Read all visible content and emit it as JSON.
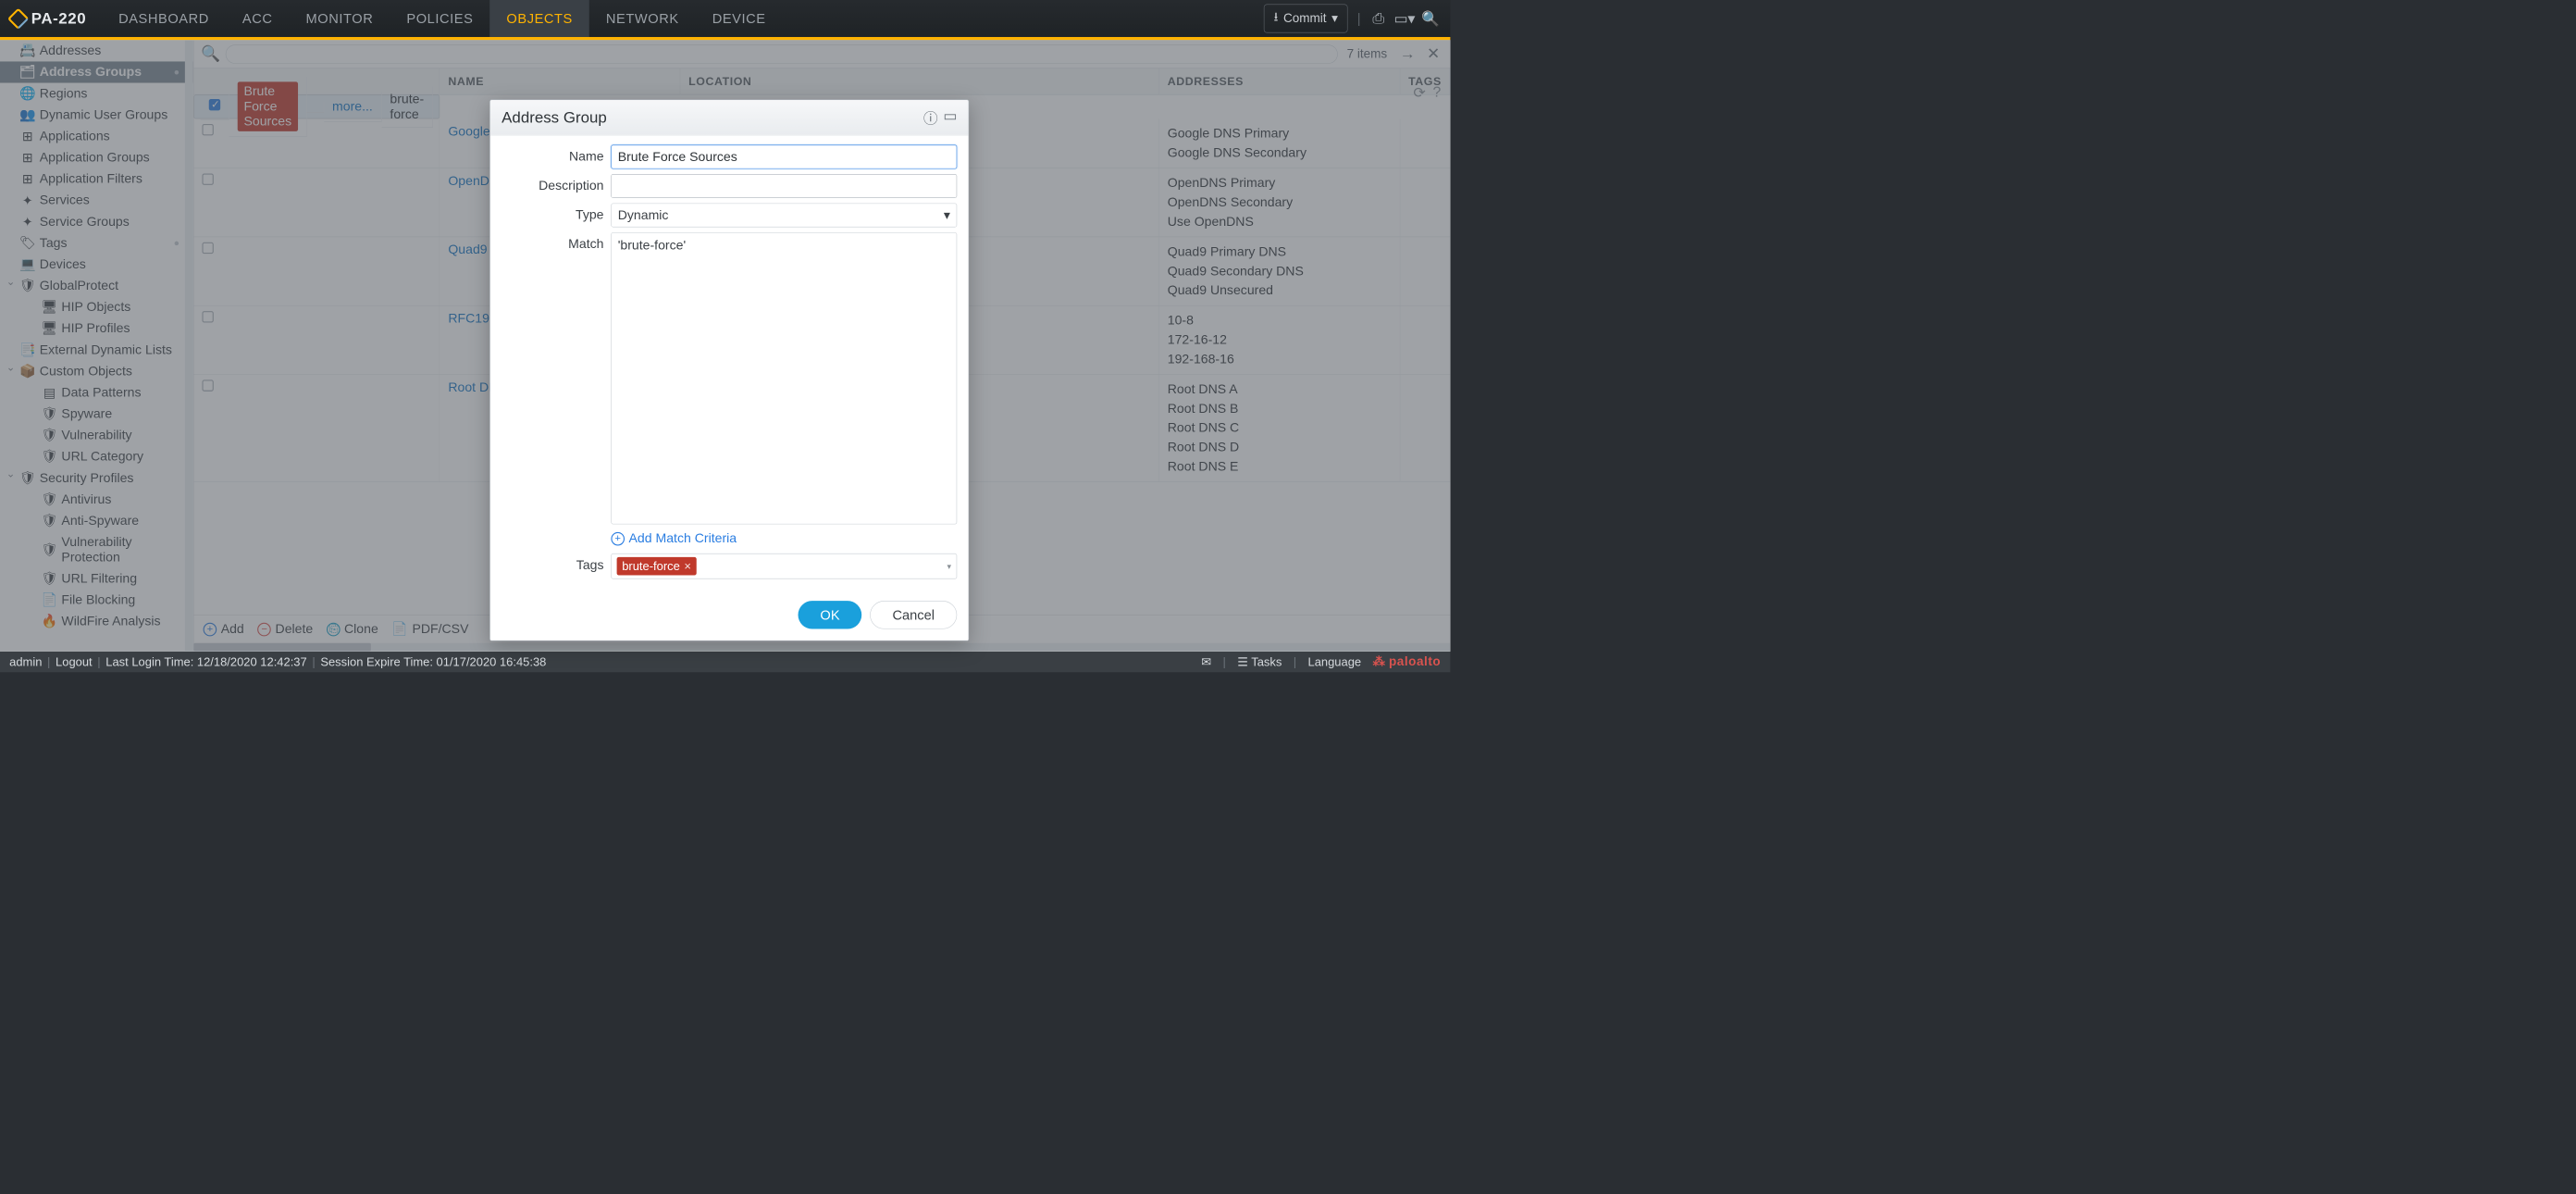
{
  "header": {
    "product": "PA-220",
    "tabs": [
      "DASHBOARD",
      "ACC",
      "MONITOR",
      "POLICIES",
      "OBJECTS",
      "NETWORK",
      "DEVICE"
    ],
    "active_tab": "OBJECTS",
    "commit_label": "Commit"
  },
  "sidebar": {
    "items": [
      {
        "label": "Addresses",
        "icon": "address-icon"
      },
      {
        "label": "Address Groups",
        "icon": "address-group-icon",
        "active": true,
        "bullet": true
      },
      {
        "label": "Regions",
        "icon": "globe-icon"
      },
      {
        "label": "Dynamic User Groups",
        "icon": "users-icon"
      },
      {
        "label": "Applications",
        "icon": "app-icon"
      },
      {
        "label": "Application Groups",
        "icon": "app-group-icon"
      },
      {
        "label": "Application Filters",
        "icon": "filter-icon"
      },
      {
        "label": "Services",
        "icon": "service-icon"
      },
      {
        "label": "Service Groups",
        "icon": "service-group-icon"
      },
      {
        "label": "Tags",
        "icon": "tag-icon",
        "bullet": true
      },
      {
        "label": "Devices",
        "icon": "device-icon"
      },
      {
        "label": "GlobalProtect",
        "icon": "gp-icon",
        "expandable": true,
        "children": [
          {
            "label": "HIP Objects",
            "icon": "hip-icon"
          },
          {
            "label": "HIP Profiles",
            "icon": "hip-icon"
          }
        ]
      },
      {
        "label": "External Dynamic Lists",
        "icon": "edl-icon"
      },
      {
        "label": "Custom Objects",
        "icon": "custom-icon",
        "expandable": true,
        "children": [
          {
            "label": "Data Patterns",
            "icon": "data-icon"
          },
          {
            "label": "Spyware",
            "icon": "spy-icon"
          },
          {
            "label": "Vulnerability",
            "icon": "vuln-icon"
          },
          {
            "label": "URL Category",
            "icon": "url-icon"
          }
        ]
      },
      {
        "label": "Security Profiles",
        "icon": "sec-icon",
        "expandable": true,
        "children": [
          {
            "label": "Antivirus",
            "icon": "av-icon"
          },
          {
            "label": "Anti-Spyware",
            "icon": "as-icon"
          },
          {
            "label": "Vulnerability Protection",
            "icon": "vp-icon"
          },
          {
            "label": "URL Filtering",
            "icon": "uf-icon"
          },
          {
            "label": "File Blocking",
            "icon": "fb-icon"
          },
          {
            "label": "WildFire Analysis",
            "icon": "wf-icon"
          }
        ]
      }
    ]
  },
  "table": {
    "items_count": "7 items",
    "columns": [
      "",
      "NAME",
      "LOCATION",
      "ADDRESSES",
      "TAGS"
    ],
    "rows": [
      {
        "checked": true,
        "name": "Brute Force Sources",
        "name_style": "badge",
        "addresses": [
          "more..."
        ],
        "addr_style": "link",
        "tags": [
          "brute-force"
        ]
      },
      {
        "checked": false,
        "name": "Google DNS",
        "name_style": "link",
        "addresses": [
          "Google DNS Primary",
          "Google DNS Secondary"
        ]
      },
      {
        "checked": false,
        "name": "OpenDNS",
        "name_style": "link",
        "addresses": [
          "OpenDNS Primary",
          "OpenDNS Secondary",
          "Use OpenDNS"
        ]
      },
      {
        "checked": false,
        "name": "Quad9",
        "name_style": "link",
        "addresses": [
          "Quad9 Primary DNS",
          "Quad9 Secondary DNS",
          "Quad9 Unsecured"
        ]
      },
      {
        "checked": false,
        "name": "RFC1918",
        "name_style": "link",
        "addresses": [
          "10-8",
          "172-16-12",
          "192-168-16"
        ]
      },
      {
        "checked": false,
        "name": "Root DNS Servers",
        "name_style": "link",
        "addresses": [
          "Root DNS A",
          "Root DNS B",
          "Root DNS C",
          "Root DNS D",
          "Root DNS E"
        ]
      }
    ]
  },
  "bottom_bar": {
    "add": "Add",
    "delete": "Delete",
    "clone": "Clone",
    "pdf": "PDF/CSV"
  },
  "modal": {
    "title": "Address Group",
    "labels": {
      "name": "Name",
      "description": "Description",
      "type": "Type",
      "match": "Match",
      "tags": "Tags"
    },
    "name_value": "Brute Force Sources",
    "description_value": "",
    "type_value": "Dynamic",
    "match_value": "'brute-force'",
    "add_criteria": "Add Match Criteria",
    "tag_value": "brute-force",
    "ok": "OK",
    "cancel": "Cancel"
  },
  "footer": {
    "user": "admin",
    "logout": "Logout",
    "last_login": "Last Login Time: 12/18/2020 12:42:37",
    "session_expire": "Session Expire Time: 01/17/2020 16:45:38",
    "tasks": "Tasks",
    "language": "Language",
    "brand": "paloalto"
  }
}
